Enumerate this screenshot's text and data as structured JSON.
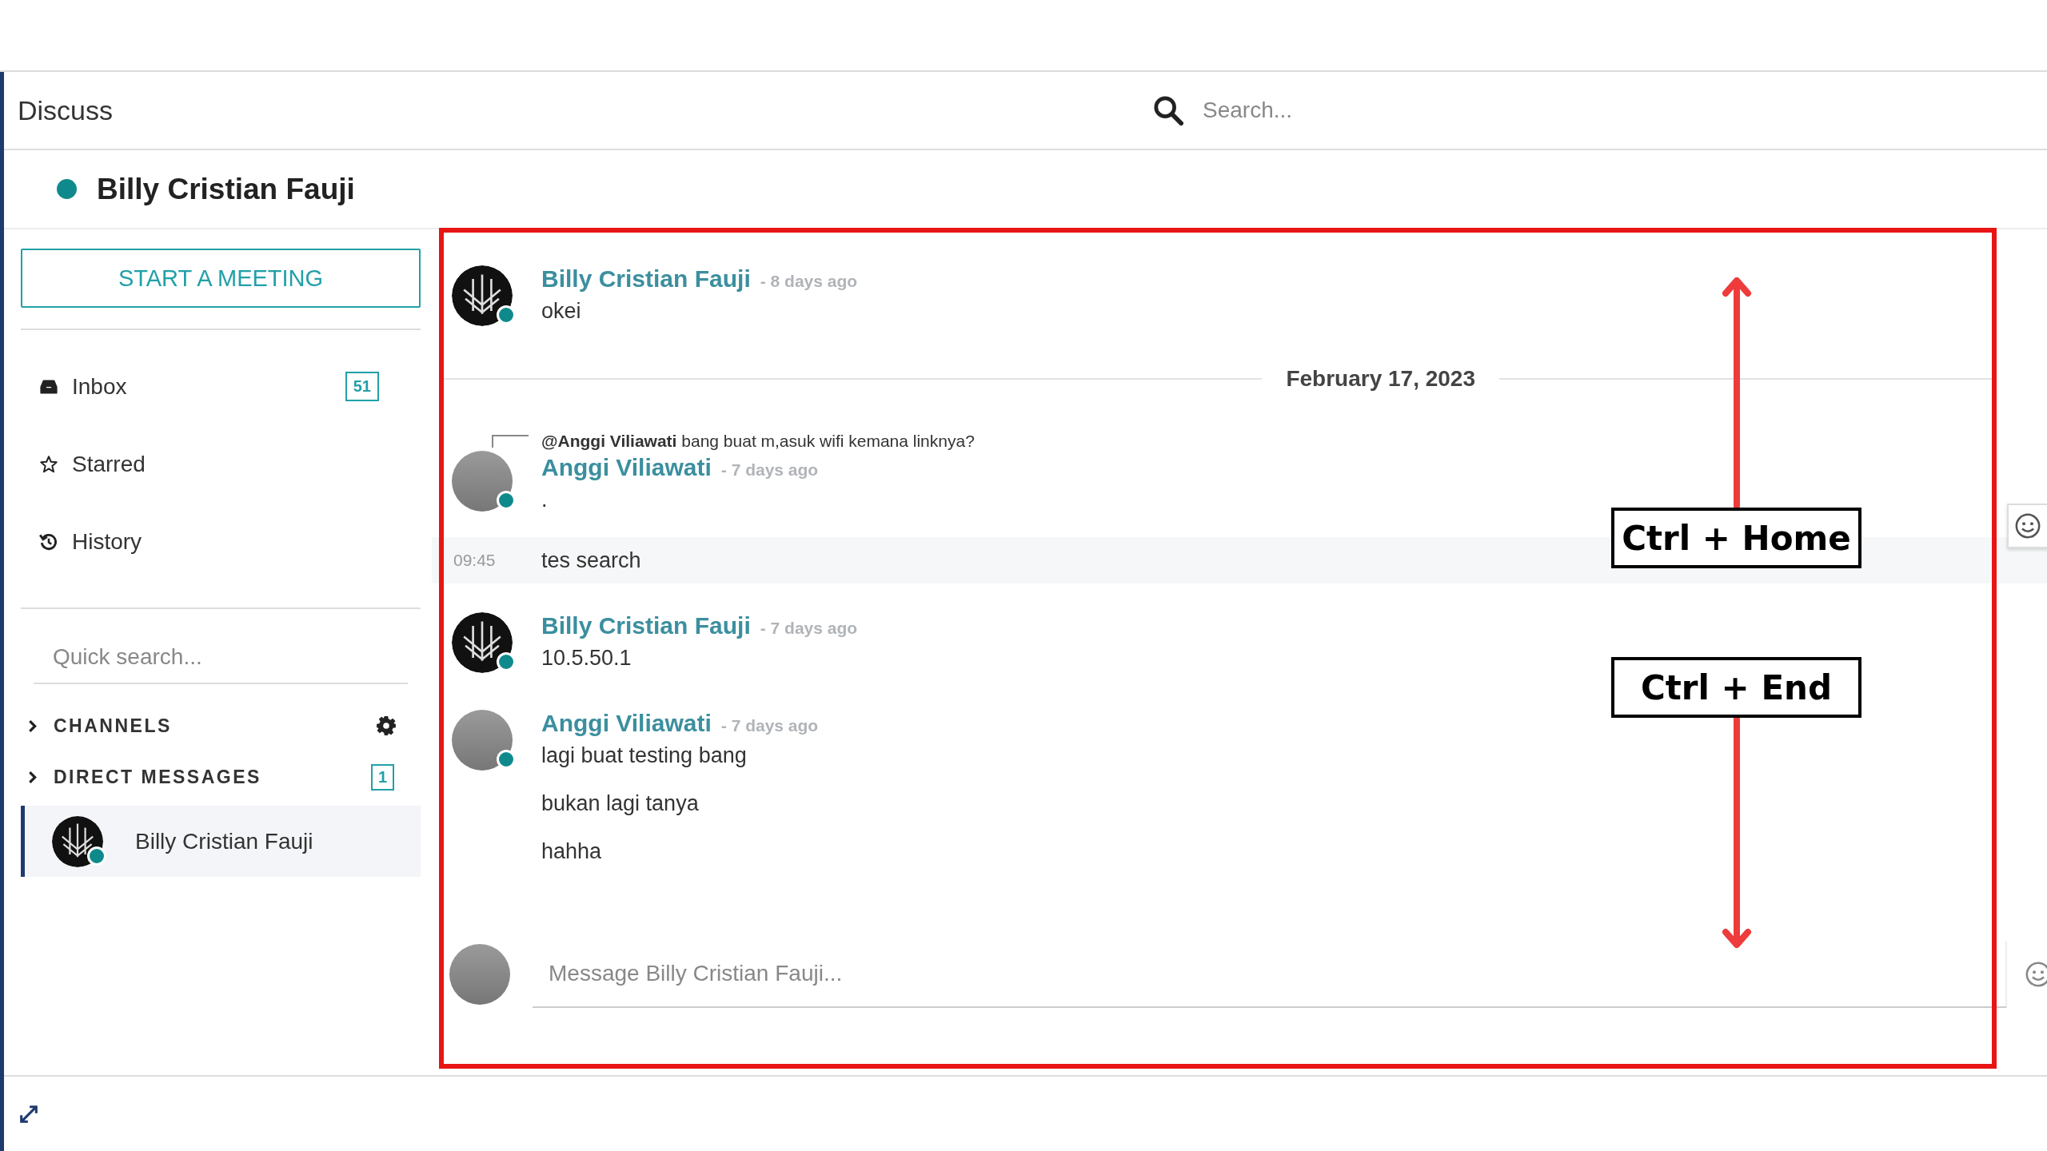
{
  "header": {
    "title": "Discuss",
    "search": {
      "placeholder": "Search..."
    }
  },
  "thread": {
    "name": "Billy Cristian Fauji",
    "online": true
  },
  "sidebar": {
    "meeting_button": "START A MEETING",
    "mailboxes": [
      {
        "label": "Inbox",
        "counter": "51"
      },
      {
        "label": "Starred"
      },
      {
        "label": "History"
      }
    ],
    "quick_search": {
      "placeholder": "Quick search..."
    },
    "categories": [
      {
        "label": "CHANNELS"
      },
      {
        "label": "DIRECT MESSAGES",
        "counter": "1",
        "items": [
          {
            "name": "Billy Cristian Fauji",
            "online": true,
            "selected": true
          }
        ]
      }
    ]
  },
  "feed": [
    {
      "kind": "message",
      "author": "Billy Cristian Fauji",
      "online": true,
      "time": "- 8 days ago",
      "lines": [
        "okei"
      ]
    },
    {
      "kind": "date",
      "label": "February 17, 2023"
    },
    {
      "kind": "message",
      "author": "Anggi Viliawati",
      "online": true,
      "time": "- 7 days ago",
      "reply": "**@Anggi Viliawati** bang buat m,asuk wifi kemana linknya?",
      "lines": [
        "."
      ]
    },
    {
      "kind": "continuation",
      "time": "09:45",
      "text": "tes search",
      "highlighted": true
    },
    {
      "kind": "message",
      "author": "Billy Cristian Fauji",
      "online": true,
      "time": "- 7 days ago",
      "lines": [
        "10.5.50.1"
      ]
    },
    {
      "kind": "message",
      "author": "Anggi Viliawati",
      "online": true,
      "time": "- 7 days ago",
      "lines": [
        "lagi buat testing bang",
        "bukan lagi tanya",
        "hahha"
      ]
    }
  ],
  "composer": {
    "placeholder": "Message Billy Cristian Fauji..."
  },
  "annotations": [
    {
      "label": "Ctrl + Home"
    },
    {
      "label": "Ctrl + End"
    }
  ]
}
